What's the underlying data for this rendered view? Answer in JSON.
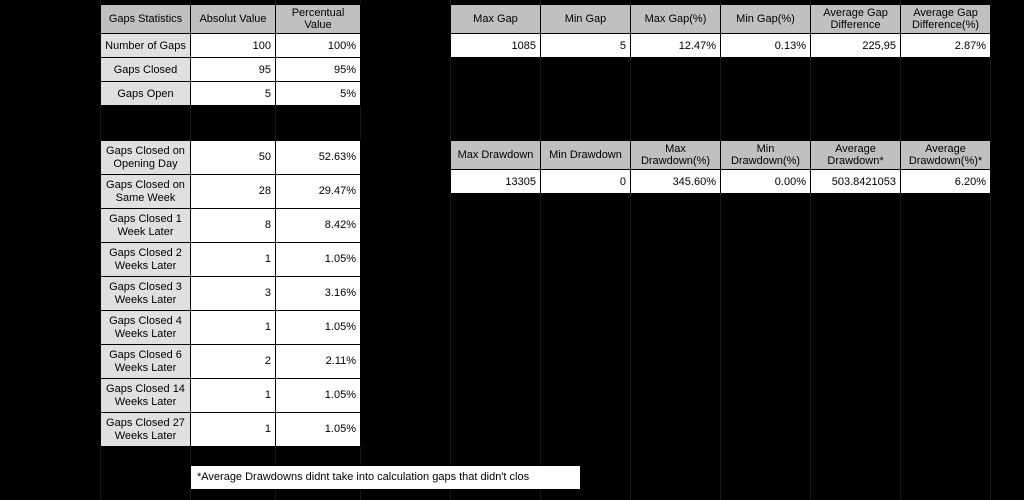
{
  "left_top": {
    "headers": [
      "Gaps Statistics",
      "Absolut Value",
      "Percentual Value"
    ],
    "rows": [
      {
        "label": "Number of Gaps",
        "abs": "100",
        "pct": "100%"
      },
      {
        "label": "Gaps Closed",
        "abs": "95",
        "pct": "95%"
      },
      {
        "label": "Gaps Open",
        "abs": "5",
        "pct": "5%"
      }
    ]
  },
  "left_mid": {
    "rows": [
      {
        "label": "Gaps Closed on Opening Day",
        "abs": "50",
        "pct": "52.63%"
      },
      {
        "label": "Gaps Closed on Same Week",
        "abs": "28",
        "pct": "29.47%"
      },
      {
        "label": "Gaps Closed 1 Week Later",
        "abs": "8",
        "pct": "8.42%"
      },
      {
        "label": "Gaps Closed 2 Weeks Later",
        "abs": "1",
        "pct": "1.05%"
      },
      {
        "label": "Gaps Closed 3 Weeks Later",
        "abs": "3",
        "pct": "3.16%"
      },
      {
        "label": "Gaps Closed 4 Weeks Later",
        "abs": "1",
        "pct": "1.05%"
      },
      {
        "label": "Gaps Closed 6 Weeks Later",
        "abs": "2",
        "pct": "2.11%"
      },
      {
        "label": "Gaps Closed 14 Weeks Later",
        "abs": "1",
        "pct": "1.05%"
      },
      {
        "label": "Gaps Closed 27 Weeks Later",
        "abs": "1",
        "pct": "1.05%"
      }
    ]
  },
  "right_top": {
    "headers": [
      "Max Gap",
      "Min Gap",
      "Max Gap(%)",
      "Min Gap(%)",
      "Average Gap Difference",
      "Average Gap Difference(%)"
    ],
    "row": [
      "1085",
      "5",
      "12.47%",
      "0.13%",
      "225,95",
      "2.87%"
    ]
  },
  "right_mid": {
    "headers": [
      "Max Drawdown",
      "Min Drawdown",
      "Max Drawdown(%)",
      "Min Drawdown(%)",
      "Average Drawdown*",
      "Average Drawdown(%)*"
    ],
    "row": [
      "13305",
      "0",
      "345.60%",
      "0.00%",
      "503.8421053",
      "6.20%"
    ]
  },
  "footnote": "*Average Drawdowns didnt take into calculation gaps that didn't clos"
}
